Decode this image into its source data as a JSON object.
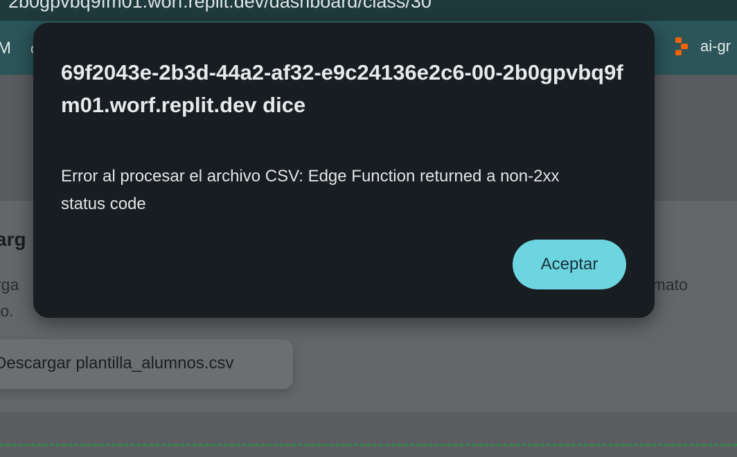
{
  "browser": {
    "url_fragment": "2b0gpvbq9fm01.worf.replit.dev/dashboard/class/30",
    "bookmark_left_1": "M",
    "bookmark_left_2": "c",
    "bookmark_right_label": "ai-gr"
  },
  "page": {
    "card_title": "arg",
    "desc_left_line1": "rga",
    "desc_left_line2": "to.",
    "desc_right_line1": "rmato",
    "download_button_label": "Descargar plantilla_alumnos.csv"
  },
  "dialog": {
    "title": "69f2043e-2b3d-44a2-af32-e9c24136e2c6-00-2b0gpvbq9fm01.worf.replit.dev dice",
    "message": "Error al procesar el archivo CSV: Edge Function returned a non-2xx status code",
    "accept_label": "Aceptar",
    "accent_color": "#6dd5e0"
  }
}
